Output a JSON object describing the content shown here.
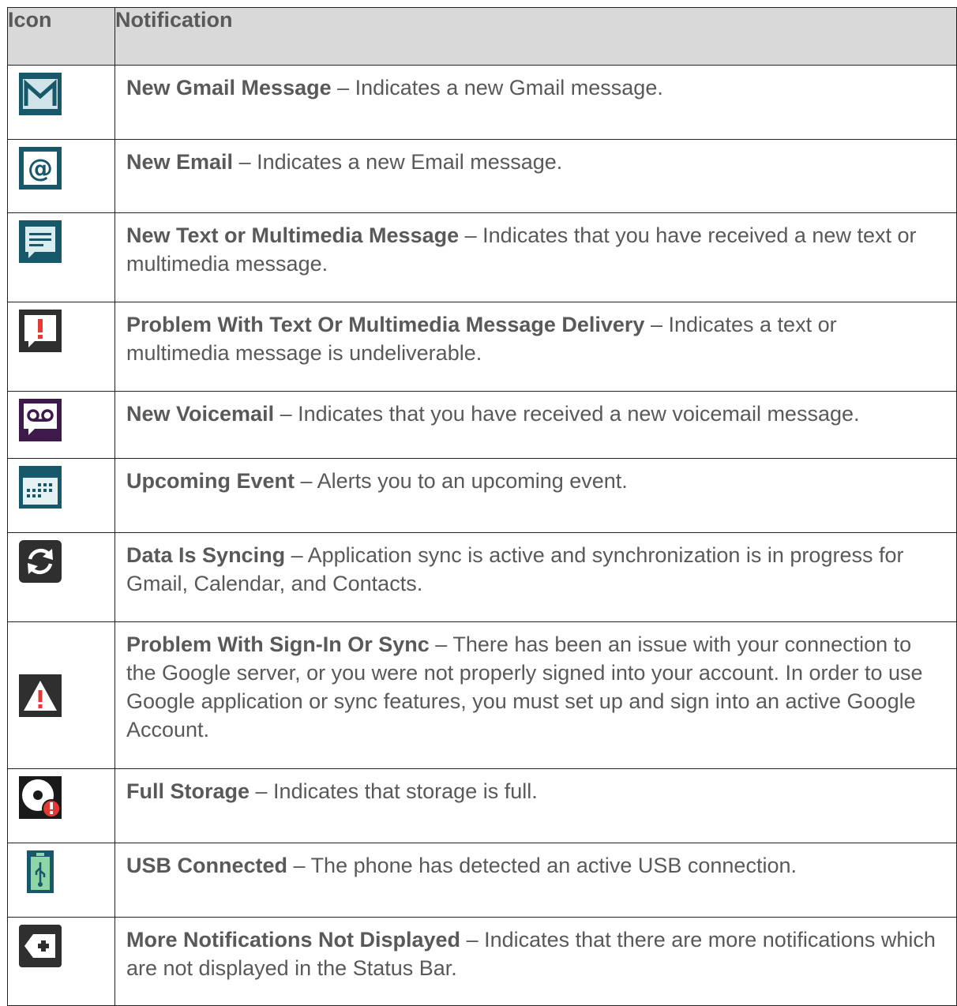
{
  "table": {
    "headers": {
      "icon": "Icon",
      "notification": "Notification"
    },
    "rows": [
      {
        "icon": "gmail-icon",
        "term": "New Gmail Message",
        "sep": " – ",
        "desc": "Indicates a new Gmail message."
      },
      {
        "icon": "email-at-icon",
        "term": "New Email",
        "sep": " – ",
        "desc": "Indicates a new Email message."
      },
      {
        "icon": "text-message-icon",
        "term": "New Text or Multimedia Message",
        "sep": " – ",
        "desc": "Indicates that you have received a new text or multimedia message."
      },
      {
        "icon": "message-alert-icon",
        "term": "Problem With Text Or Multimedia Message Delivery",
        "sep": " – ",
        "desc": "Indicates a text or multimedia message is undeliverable."
      },
      {
        "icon": "voicemail-icon",
        "term": "New Voicemail",
        "sep": " – ",
        "desc": "Indicates that you have received a new voicemail message."
      },
      {
        "icon": "calendar-icon",
        "term": "Upcoming Event",
        "sep": " – ",
        "desc": "Alerts you to an upcoming event."
      },
      {
        "icon": "sync-icon",
        "term": "Data Is Syncing",
        "sep": " – ",
        "desc": "Application sync is active and synchronization is in progress for Gmail, Calendar, and Contacts."
      },
      {
        "icon": "warning-icon",
        "term": "Problem With Sign-In Or Sync",
        "sep": " – ",
        "desc": "There has been an issue with your connection to the Google server, or you were not properly signed into your account. In order to use Google application or sync features, you must set up and sign into an active Google Account."
      },
      {
        "icon": "storage-full-icon",
        "term": "Full Storage",
        "sep": " – ",
        "desc": "Indicates that storage is full."
      },
      {
        "icon": "usb-icon",
        "term": "USB Connected",
        "sep": " – ",
        "desc": "The phone has detected an active USB connection."
      },
      {
        "icon": "more-notifications-icon",
        "term": "More Notifications Not Displayed",
        "sep": " – ",
        "desc": "Indicates that there are more notifications which are not displayed in the Status Bar."
      }
    ]
  },
  "colors": {
    "header_bg": "#d9d9d9",
    "text": "#595959",
    "teal_icon": "#17586a",
    "dark_icon": "#2f2f2f",
    "voicemail_icon": "#3d1a4a",
    "alert_red": "#e53935"
  }
}
